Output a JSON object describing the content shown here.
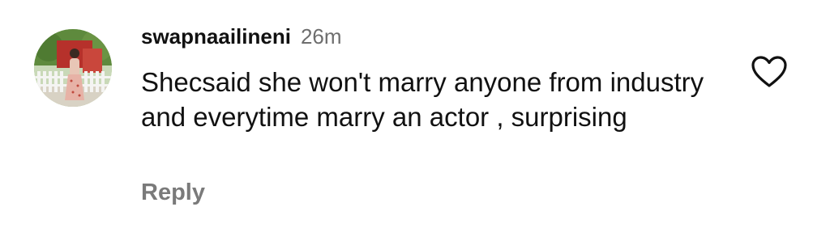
{
  "comment": {
    "username": "swapnaailineni",
    "time": "26m",
    "text": "Shecsaid she won't marry anyone from industry and everytime marry an actor , surprising",
    "reply_label": "Reply",
    "like_icon": "heart-outline-icon",
    "avatar_alt": "profile photo"
  }
}
